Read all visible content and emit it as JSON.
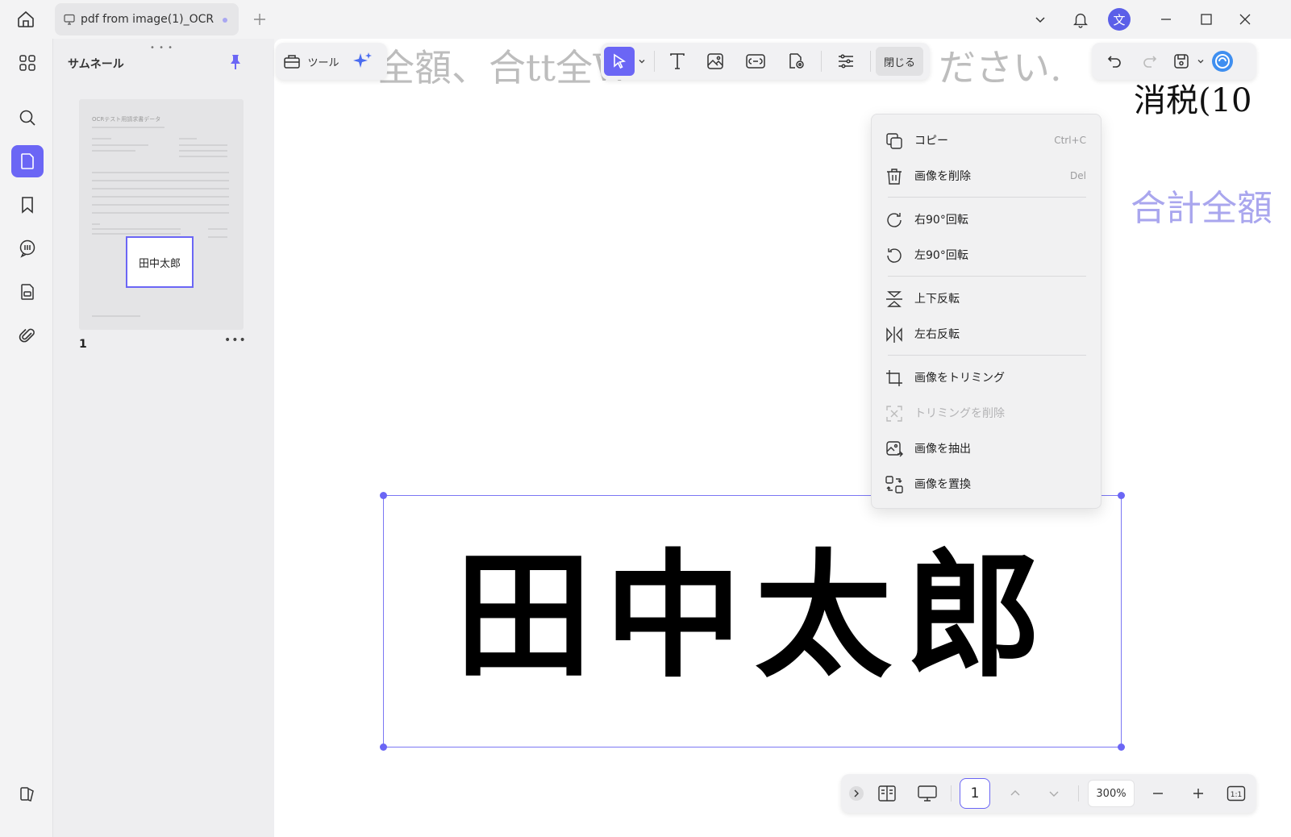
{
  "window": {
    "tab_title": "pdf from image(1)_OCR",
    "avatar_letter": "文"
  },
  "sidebar": {
    "panel_title": "サムネール",
    "page_number": "1",
    "thumb_doc_title": "OCRテスト用請求書データ",
    "thumb_signature": "田中太郎"
  },
  "toolbar": {
    "tools_label": "ツール",
    "close_label": "閉じる"
  },
  "document": {
    "ghost_text_left": "全額、合tt全W",
    "ghost_text_right": "ださい.",
    "right_text_top": "消税(10",
    "right_text_mid": "合計全額",
    "signature_text": "田中太郎"
  },
  "context_menu": {
    "items": [
      {
        "label": "コピー",
        "shortcut": "Ctrl+C"
      },
      {
        "label": "画像を削除",
        "shortcut": "Del"
      },
      {
        "label": "右90°回転",
        "shortcut": ""
      },
      {
        "label": "左90°回転",
        "shortcut": ""
      },
      {
        "label": "上下反転",
        "shortcut": ""
      },
      {
        "label": "左右反転",
        "shortcut": ""
      },
      {
        "label": "画像をトリミング",
        "shortcut": ""
      },
      {
        "label": "トリミングを削除",
        "shortcut": ""
      },
      {
        "label": "画像を抽出",
        "shortcut": ""
      },
      {
        "label": "画像を置換",
        "shortcut": ""
      }
    ]
  },
  "bottom_bar": {
    "page_input": "1",
    "zoom": "300%",
    "fit_label": "1:1"
  },
  "colors": {
    "accent": "#6b66f5",
    "background": "#f3f3f4",
    "menu_bg": "#f1f1f2"
  }
}
